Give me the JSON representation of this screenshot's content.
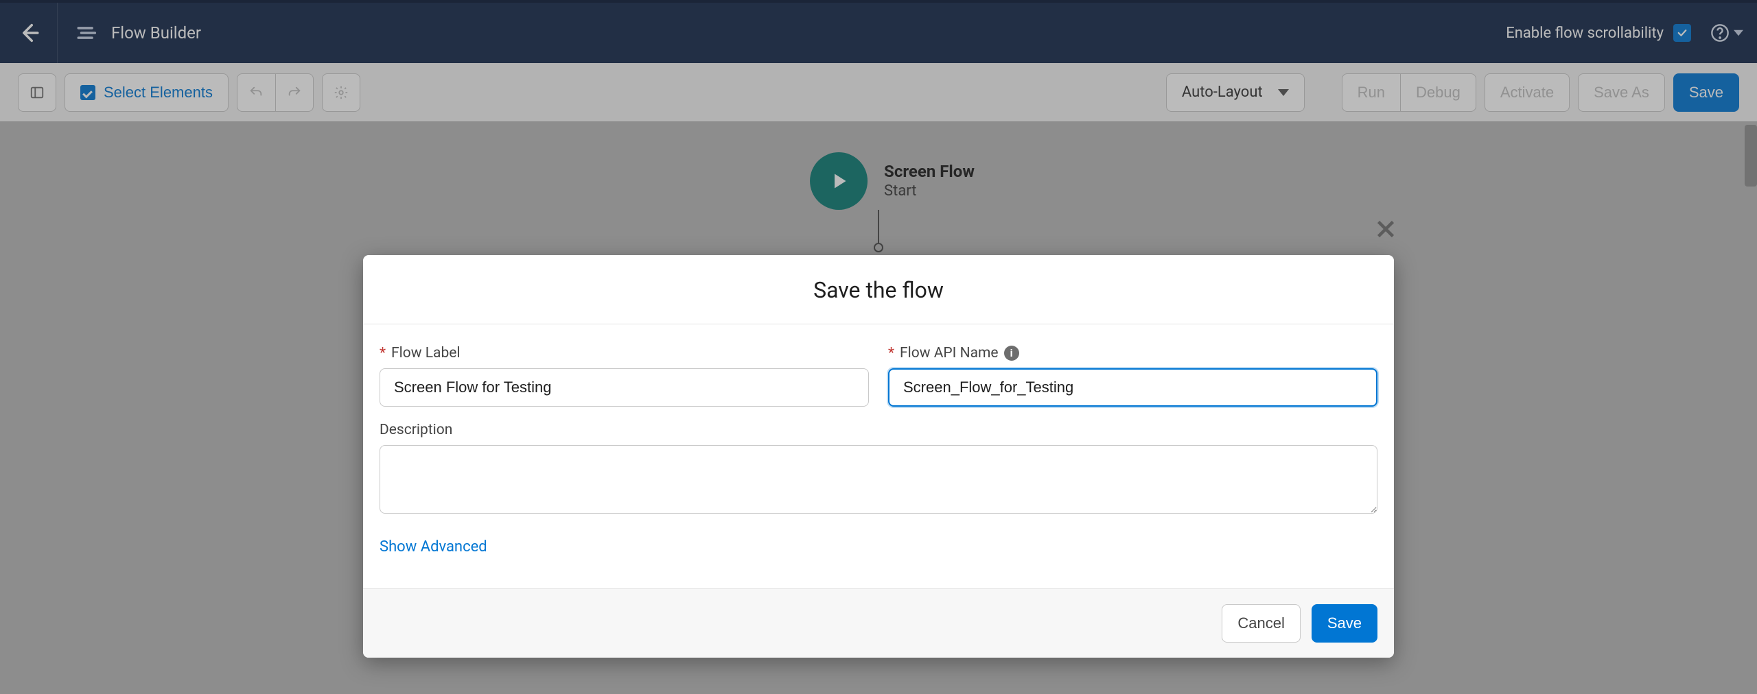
{
  "topbar": {
    "title": "Flow Builder",
    "scroll_toggle_label": "Enable flow scrollability",
    "scroll_toggle_checked": true
  },
  "toolbar": {
    "select_elements_label": "Select Elements",
    "layout_mode": "Auto-Layout",
    "run_label": "Run",
    "debug_label": "Debug",
    "activate_label": "Activate",
    "save_as_label": "Save As",
    "save_label": "Save"
  },
  "canvas": {
    "start_node": {
      "title": "Screen Flow",
      "subtitle": "Start"
    }
  },
  "modal": {
    "title": "Save the flow",
    "flow_label_label": "Flow Label",
    "flow_label_value": "Screen Flow for Testing",
    "api_name_label": "Flow API Name",
    "api_name_value": "Screen_Flow_for_Testing",
    "description_label": "Description",
    "description_value": "",
    "show_advanced_label": "Show Advanced",
    "cancel_label": "Cancel",
    "save_label": "Save"
  }
}
